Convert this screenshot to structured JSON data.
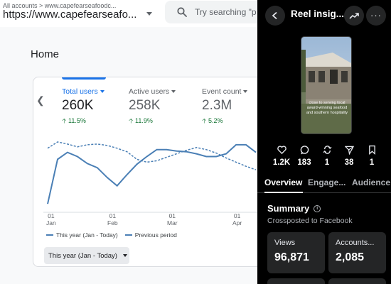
{
  "analytics": {
    "breadcrumb": "All accounts > www.capefearseafoodc...",
    "account": "https://www.capefearseafo...",
    "search_placeholder": "Try searching \"p",
    "page_title": "Home",
    "metrics": [
      {
        "label": "Total users",
        "value": "260K",
        "change": "11.5%"
      },
      {
        "label": "Active users",
        "value": "258K",
        "change": "11.9%"
      },
      {
        "label": "Event count",
        "value": "2.3M",
        "change": "5.2%"
      }
    ],
    "x_ticks": [
      {
        "day": "01",
        "month": "Jan"
      },
      {
        "day": "01",
        "month": "Feb"
      },
      {
        "day": "01",
        "month": "Mar"
      },
      {
        "day": "01",
        "month": "Apr"
      }
    ],
    "legend": {
      "current": "This year (Jan - Today)",
      "previous": "Previous period"
    },
    "date_range": "This year (Jan - Today)",
    "colors": {
      "accent": "#1a73e8",
      "line": "#4a7fb5",
      "positive": "#137333"
    }
  },
  "chart_data": {
    "type": "line",
    "series": [
      {
        "name": "This year (Jan - Today)",
        "values": [
          0.08,
          0.72,
          0.82,
          0.76,
          0.66,
          0.6,
          0.46,
          0.34,
          0.5,
          0.65,
          0.76,
          0.86,
          0.86,
          0.84,
          0.83,
          0.8,
          0.76,
          0.76,
          0.8,
          0.93,
          0.93,
          0.82
        ]
      },
      {
        "name": "Previous period",
        "values": [
          0.88,
          0.97,
          0.94,
          0.9,
          0.93,
          0.94,
          0.92,
          0.88,
          0.83,
          0.72,
          0.68,
          0.7,
          0.75,
          0.8,
          0.85,
          0.89,
          0.86,
          0.81,
          0.74,
          0.68,
          0.62,
          0.57
        ]
      }
    ],
    "x_ticks": [
      "01 Jan",
      "01 Feb",
      "01 Mar",
      "01 Apr"
    ]
  },
  "reel": {
    "title": "Reel insig...",
    "thumbnail_caption": "close to serving local award-winning seafood and southern hospitality",
    "stats": [
      {
        "icon": "heart-icon",
        "value": "1.2K"
      },
      {
        "icon": "comment-icon",
        "value": "183"
      },
      {
        "icon": "repost-icon",
        "value": "1"
      },
      {
        "icon": "send-icon",
        "value": "38"
      },
      {
        "icon": "bookmark-icon",
        "value": "1"
      }
    ],
    "tabs": [
      "Overview",
      "Engage...",
      "Audience"
    ],
    "summary_title": "Summary",
    "summary_sub": "Crossposted to Facebook",
    "kpis": [
      {
        "label": "Views",
        "value": "96,871"
      },
      {
        "label": "Accounts...",
        "value": "2,085"
      }
    ]
  }
}
